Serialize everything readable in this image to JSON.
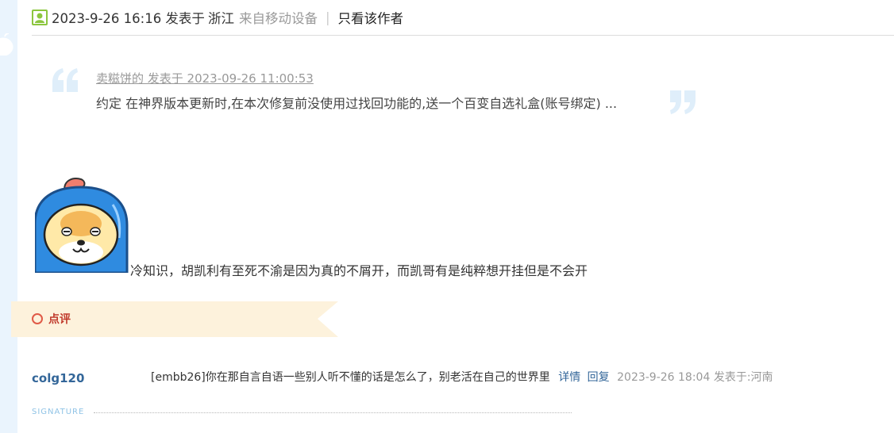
{
  "post": {
    "time": "2023-9-26 16:16 发表于",
    "location": "浙江",
    "device": "来自移动设备",
    "separator": "|",
    "only_author": "只看该作者"
  },
  "quote": {
    "meta": "卖糍饼的 发表于 2023-09-26 11:00:53",
    "body": "约定 在神界版本更新时,在本次修复前没使用过找回功能的,送一个百变自选礼盒(账号绑定) ..."
  },
  "post_body": {
    "text": "冷知识，胡凯利有至死不渝是因为真的不屑开，而凯哥有是纯粹想开挂但是不会开"
  },
  "comments": {
    "label": "点评",
    "items": [
      {
        "user": "colg120",
        "text": "[embb26]你在那自言自语一些别人听不懂的话是怎么了，别老活在自己的世界里",
        "detail": "详情",
        "reply": "回复",
        "meta": "2023-9-26 18:04 发表于:河南"
      }
    ]
  },
  "signature": {
    "label": "SIGNATURE"
  },
  "colors": {
    "link": "#336699",
    "muted": "#999999",
    "banner": "#fdf2dc",
    "accent": "#e05a47",
    "strip": "#eaf4fd"
  }
}
